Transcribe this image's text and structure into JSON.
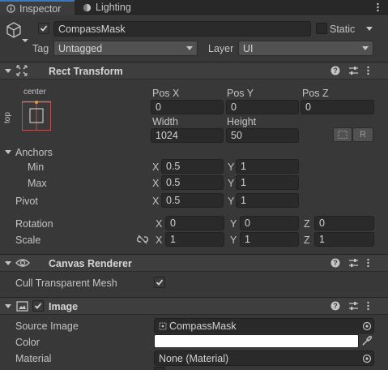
{
  "tabs": [
    {
      "label": "Inspector",
      "icon": "info-icon"
    },
    {
      "label": "Lighting",
      "icon": "lighting-icon"
    }
  ],
  "header": {
    "object_name": "CompassMask",
    "static_label": "Static",
    "tag_label": "Tag",
    "tag_value": "Untagged",
    "layer_label": "Layer",
    "layer_value": "UI"
  },
  "rect_transform": {
    "title": "Rect Transform",
    "anchor_preset_top": "center",
    "anchor_preset_side": "top",
    "labels": {
      "pos_x": "Pos X",
      "pos_y": "Pos Y",
      "pos_z": "Pos Z",
      "width": "Width",
      "height": "Height"
    },
    "values": {
      "pos_x": "0",
      "pos_y": "0",
      "pos_z": "0",
      "width": "1024",
      "height": "50"
    },
    "r_button": "R",
    "anchors_label": "Anchors",
    "min_label": "Min",
    "min_x": "0.5",
    "min_y": "1",
    "max_label": "Max",
    "max_x": "0.5",
    "max_y": "1",
    "pivot_label": "Pivot",
    "pivot_x": "0.5",
    "pivot_y": "1",
    "rotation_label": "Rotation",
    "rotation": {
      "x": "0",
      "y": "0",
      "z": "0"
    },
    "scale_label": "Scale",
    "scale": {
      "x": "1",
      "y": "1",
      "z": "1"
    },
    "axis_x": "X",
    "axis_y": "Y",
    "axis_z": "Z"
  },
  "canvas_renderer": {
    "title": "Canvas Renderer",
    "cull_label": "Cull Transparent Mesh",
    "cull_checked": true
  },
  "image": {
    "title": "Image",
    "source_image_label": "Source Image",
    "source_image_value": "CompassMask",
    "color_label": "Color",
    "color_value": "#ffffff",
    "material_label": "Material",
    "material_value": "None (Material)"
  },
  "colors": {
    "accent": "#3a79bb",
    "background": "#383838",
    "field": "#2a2a2a"
  }
}
